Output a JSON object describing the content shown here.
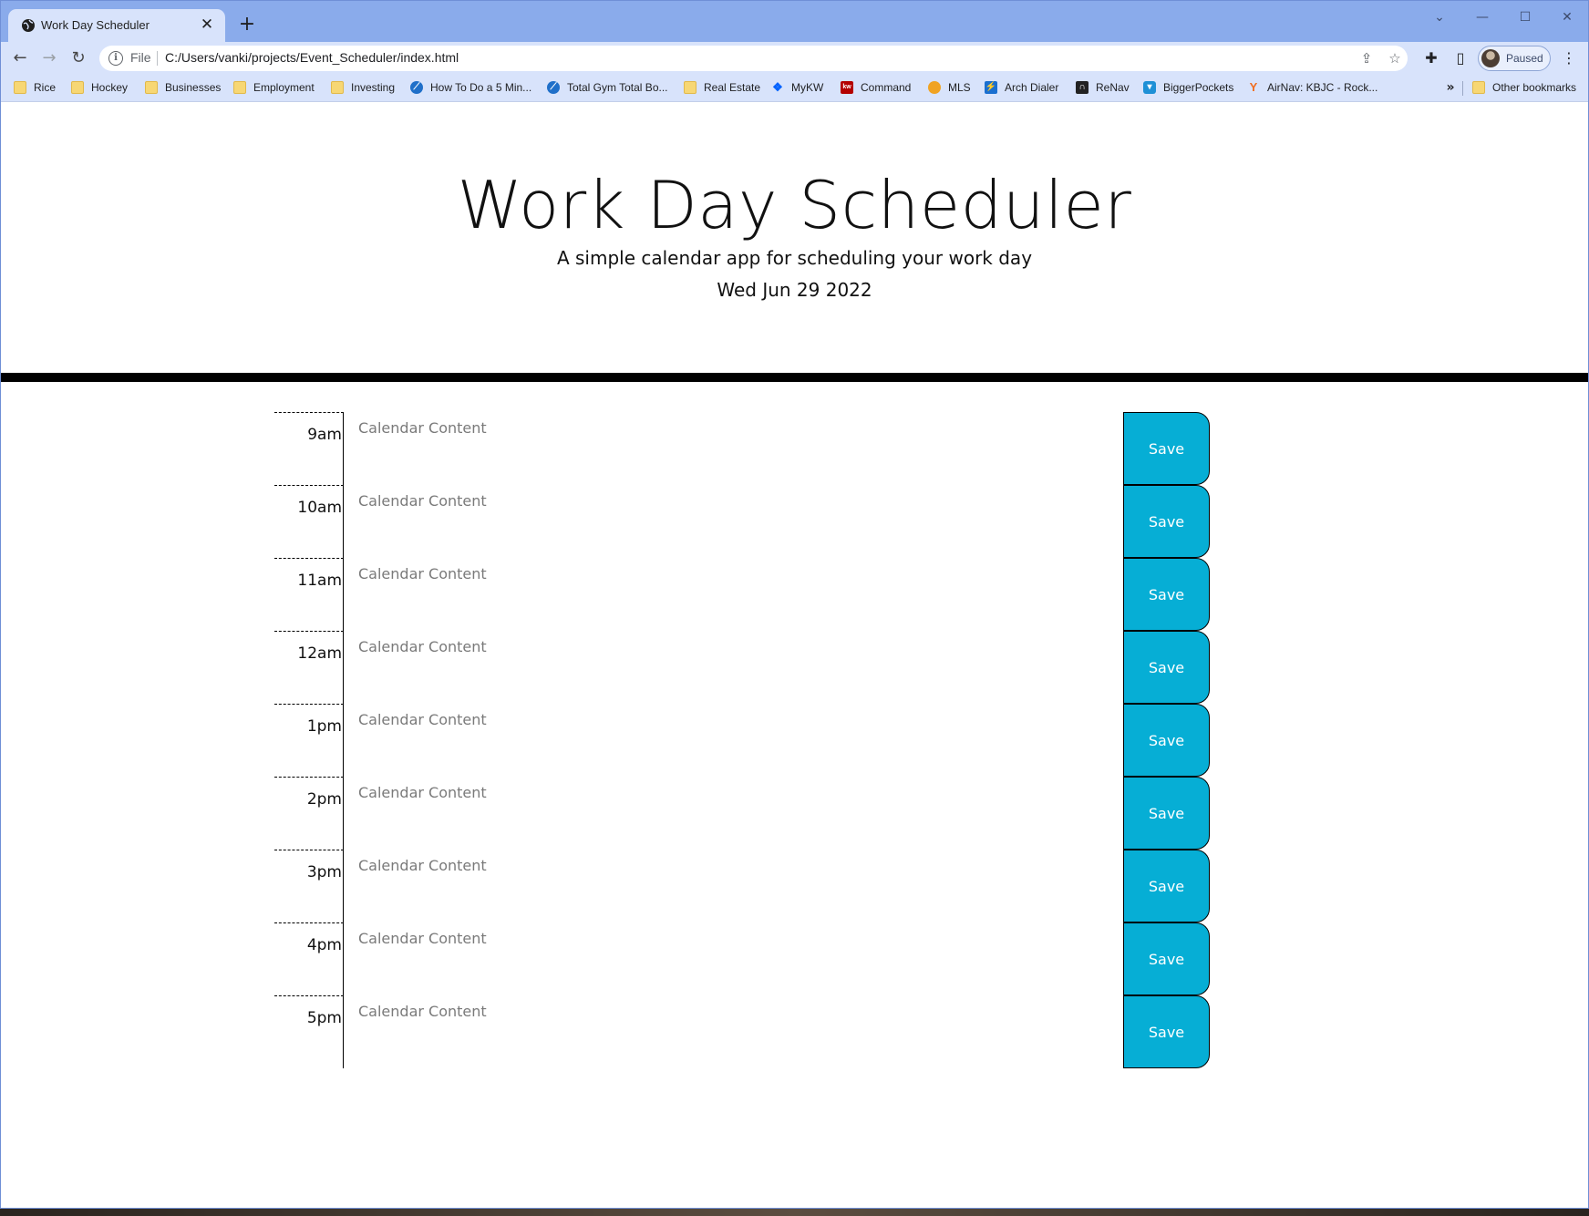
{
  "browser": {
    "tab_title": "Work Day Scheduler",
    "tab_close": "✕",
    "new_tab": "+",
    "address_scheme": "File",
    "address_url": "C:/Users/vanki/projects/Event_Scheduler/index.html",
    "profile_label": "Paused",
    "bookmarks": [
      {
        "label": "Rice",
        "icon": "folder-icon"
      },
      {
        "label": "Hockey",
        "icon": "folder-icon"
      },
      {
        "label": "Businesses",
        "icon": "folder-icon"
      },
      {
        "label": "Employment",
        "icon": "folder-icon"
      },
      {
        "label": "Investing",
        "icon": "folder-icon"
      },
      {
        "label": "How To Do a 5 Min...",
        "icon": "site-icon"
      },
      {
        "label": "Total Gym Total Bo...",
        "icon": "site-icon"
      },
      {
        "label": "Real Estate",
        "icon": "folder-icon"
      },
      {
        "label": "MyKW",
        "icon": "dropbox-icon"
      },
      {
        "label": "Command",
        "icon": "kw-icon"
      },
      {
        "label": "MLS",
        "icon": "mls-icon"
      },
      {
        "label": "Arch Dialer",
        "icon": "arch-icon"
      },
      {
        "label": "ReNav",
        "icon": "renav-icon"
      },
      {
        "label": "BiggerPockets",
        "icon": "biggerpockets-icon"
      },
      {
        "label": "AirNav: KBJC - Rock...",
        "icon": "airnav-icon"
      }
    ],
    "bookmarks_more": "»",
    "other_bookmarks": "Other bookmarks"
  },
  "header": {
    "title": "Work Day Scheduler",
    "lead": "A simple calendar app for scheduling your work day",
    "current_day": "Wed Jun 29 2022"
  },
  "schedule": {
    "placeholder": "Calendar Content",
    "save_label": "Save",
    "hours": [
      "9am",
      "10am",
      "11am",
      "12am",
      "1pm",
      "2pm",
      "3pm",
      "4pm",
      "5pm"
    ]
  },
  "colors": {
    "save_button": "#06aed5",
    "divider": "#000000",
    "titlebar": "#8aabeb",
    "toolbar": "#d8e3fb"
  }
}
